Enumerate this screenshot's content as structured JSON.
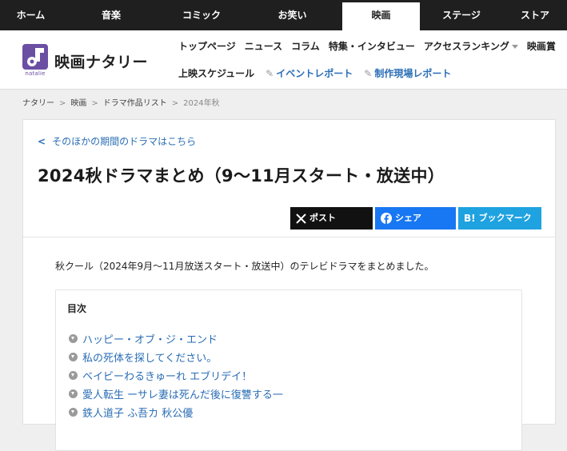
{
  "topnav": {
    "tabs": [
      {
        "label": "ホーム"
      },
      {
        "label": "音楽"
      },
      {
        "label": "コミック"
      },
      {
        "label": "お笑い"
      },
      {
        "label": "映画"
      },
      {
        "label": "ステージ"
      },
      {
        "label": "ストア"
      }
    ],
    "active_tab": "映画"
  },
  "header": {
    "site_title": "映画ナタリー",
    "logo_sub": "natalie",
    "nav_primary": [
      "トップページ",
      "ニュース",
      "コラム",
      "特集・インタビュー",
      "アクセスランキング",
      "映画賞"
    ],
    "nav_secondary": {
      "schedule": "上映スケジュール",
      "event_report": "イベントレポート",
      "production_report": "制作現場レポート"
    }
  },
  "breadcrumb": [
    "ナタリー",
    "映画",
    "ドラマ作品リスト",
    "2024年秋"
  ],
  "article": {
    "back_link": "そのほかの期間のドラマはこちら",
    "title": "2024秋ドラマまとめ（9〜11月スタート・放送中）",
    "share": {
      "x": "ポスト",
      "facebook": "シェア",
      "hatena": "ブックマーク"
    },
    "intro": "秋クール（2024年9月〜11月放送スタート・放送中）のテレビドラマをまとめました。",
    "toc": {
      "title": "目次",
      "items": [
        "ハッピー・オブ・ジ・エンド",
        "私の死体を探してください。",
        "ベイビーわるきゅーれ エブリデイ！",
        "愛人転生 ーサレ妻は死んだ後に復讐する一",
        "鉄人道子 ふ吾カ 秋公優"
      ]
    }
  },
  "colors": {
    "topbar": "#1f1f1f",
    "link": "#2a6db5",
    "brand_purple": "#6b4fa3",
    "x_button": "#111111",
    "facebook_button": "#1877f2",
    "hatena_button": "#1fa2e0"
  }
}
